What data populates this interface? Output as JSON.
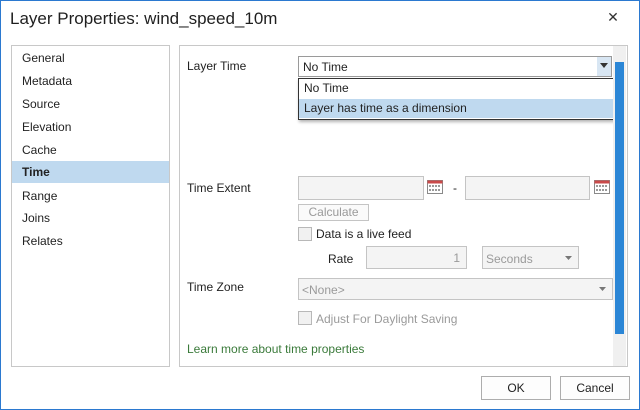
{
  "dialog": {
    "title": "Layer Properties: wind_speed_10m",
    "close_glyph": "✕"
  },
  "sidebar": {
    "items": [
      {
        "label": "General"
      },
      {
        "label": "Metadata"
      },
      {
        "label": "Source"
      },
      {
        "label": "Elevation"
      },
      {
        "label": "Cache"
      },
      {
        "label": "Time",
        "selected": true
      },
      {
        "label": "Range"
      },
      {
        "label": "Joins"
      },
      {
        "label": "Relates"
      }
    ]
  },
  "time": {
    "layer_time_label": "Layer Time",
    "layer_time_value": "No Time",
    "layer_time_options": [
      "No Time",
      "Layer has time as a dimension"
    ],
    "highlighted_option": "Layer has time as a dimension",
    "time_extent_label": "Time Extent",
    "extent_separator": "-",
    "calculate_label": "Calculate",
    "live_feed_label": "Data is a live feed",
    "rate_label": "Rate",
    "rate_value": "1",
    "rate_unit": "Seconds",
    "time_zone_label": "Time Zone",
    "time_zone_value": "<None>",
    "daylight_label": "Adjust For Daylight Saving",
    "learn_more_link": "Learn more about time properties"
  },
  "footer": {
    "ok_label": "OK",
    "cancel_label": "Cancel"
  },
  "colors": {
    "accent": "#2b79d0",
    "selection": "#bfd9ef",
    "link": "#3a7a3a",
    "scroll_thumb": "#2b86d6"
  }
}
